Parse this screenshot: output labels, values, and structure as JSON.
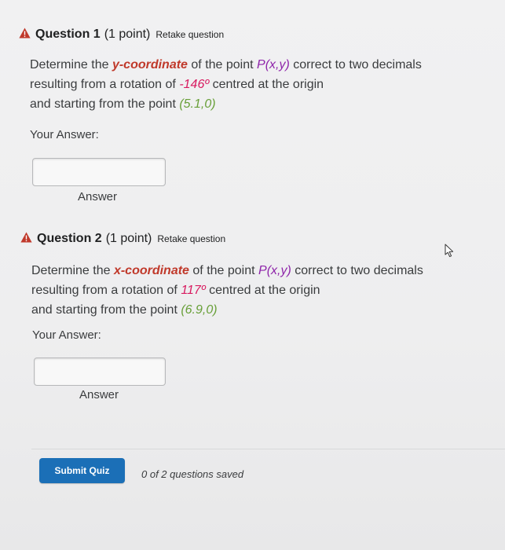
{
  "questions": [
    {
      "title": "Question 1",
      "points": "(1 point)",
      "retake": "Retake question",
      "line1_a": "Determine the ",
      "line1_coord": "y-coordinate",
      "line1_b": " of the point ",
      "line1_point": "P(x,y)",
      "line1_c": " correct to two decimals",
      "line2_a": "resulting from a rotation of ",
      "line2_angle": "-146º",
      "line2_b": " centred at the origin",
      "line3_a": "and starting from the point ",
      "line3_start": "(5.1,0)",
      "your_answer": "Your Answer:",
      "answer_value": "",
      "answer_label": "Answer"
    },
    {
      "title": "Question 2",
      "points": "(1 point)",
      "retake": "Retake question",
      "line1_a": "Determine the ",
      "line1_coord": "x-coordinate",
      "line1_b": " of the point ",
      "line1_point": "P(x,y)",
      "line1_c": " correct to two decimals",
      "line2_a": "resulting from a rotation of ",
      "line2_angle": "117º",
      "line2_b": " centred at the origin",
      "line3_a": "and starting from the point ",
      "line3_start": "(6.9,0)",
      "your_answer": "Your Answer:",
      "answer_value": "",
      "answer_label": "Answer"
    }
  ],
  "footer": {
    "submit_label": "Submit Quiz",
    "saved_status": "0 of 2 questions saved"
  },
  "icons": {
    "warning": "warning-triangle-icon",
    "cursor": "mouse-pointer-icon"
  },
  "colors": {
    "warning": "#c0392b",
    "coordinate": "#c0392b",
    "point": "#8e24aa",
    "angle": "#d81b60",
    "start_point": "#689f38",
    "submit_button": "#1b6fb7"
  }
}
